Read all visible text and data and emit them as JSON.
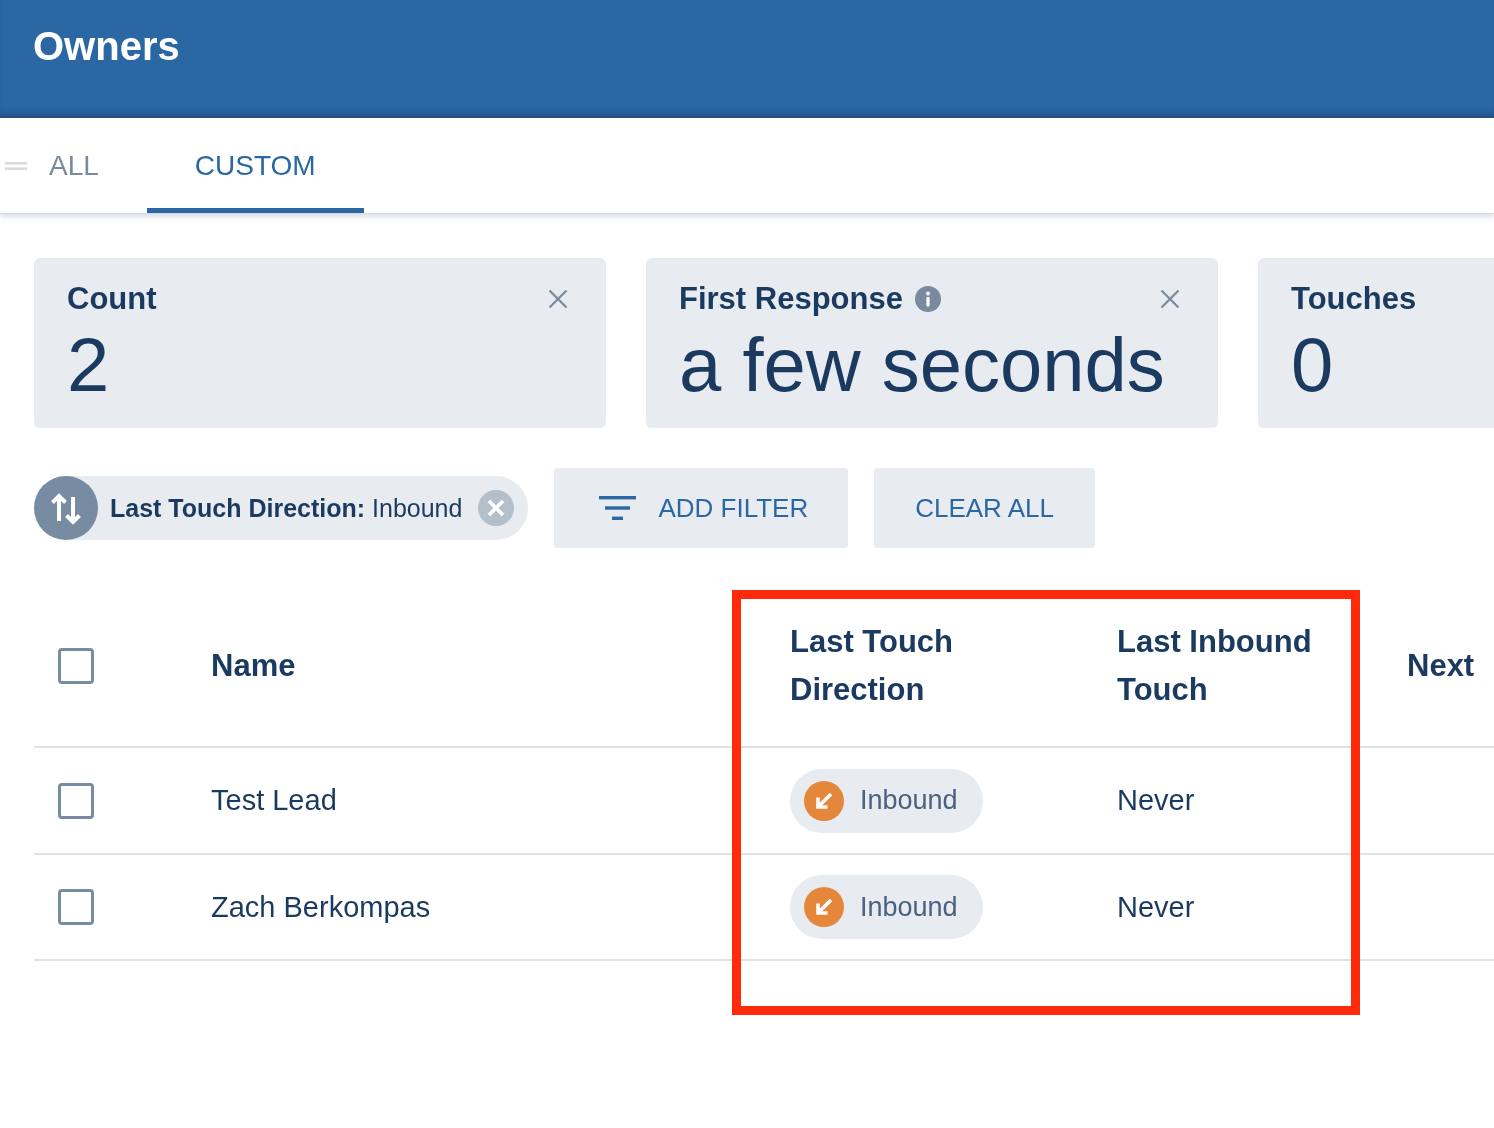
{
  "header": {
    "title": "Owners"
  },
  "tabs": [
    {
      "label": "ALL",
      "selected": false
    },
    {
      "label": "CUSTOM",
      "selected": true
    }
  ],
  "metrics": [
    {
      "title": "Count",
      "value": "2",
      "info": false,
      "closable": true
    },
    {
      "title": "First Response",
      "value": "a few seconds",
      "info": true,
      "closable": true
    },
    {
      "title": "Touches",
      "value": "0",
      "info": false,
      "closable": false
    }
  ],
  "filters": {
    "chips": [
      {
        "text": "**Last Touch Direction:** Inbound"
      }
    ],
    "buttons": [
      {
        "kind": "add",
        "label": "ADD FILTER"
      },
      {
        "kind": "clear",
        "label": "CLEAR ALL"
      }
    ]
  },
  "table": {
    "select_all_checked": false,
    "columns": [
      {
        "label": "Name",
        "highlighted": false
      },
      {
        "label": "Last Touch Direction",
        "highlighted": true
      },
      {
        "label": "Last Inbound Touch",
        "highlighted": true
      },
      {
        "label": "Next",
        "highlighted": false
      }
    ],
    "rows": [
      {
        "checked": false,
        "name": "Test Lead",
        "direction": {
          "kind": "inbound",
          "label": "Inbound",
          "color": "#e5873a"
        },
        "last_inbound_touch": "Never"
      },
      {
        "checked": false,
        "name": "Zach Berkompas",
        "direction": {
          "kind": "inbound",
          "label": "Inbound",
          "color": "#e5873a"
        },
        "last_inbound_touch": "Never"
      }
    ]
  }
}
